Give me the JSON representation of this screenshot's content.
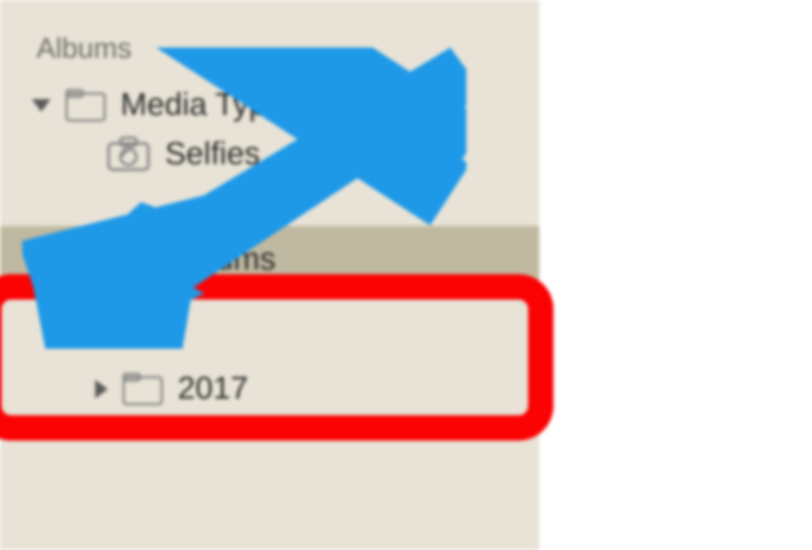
{
  "sidebar": {
    "section_header": "Albums",
    "items": [
      {
        "label": "Media Types",
        "expanded": true
      },
      {
        "label": "Selfies",
        "expanded": false
      },
      {
        "label": "My Albums",
        "expanded": true,
        "selected": true
      },
      {
        "label": "2017",
        "expanded": false
      }
    ]
  },
  "annotation": {
    "arrow_color": "#1e99e8",
    "box_color": "#fb0203"
  }
}
